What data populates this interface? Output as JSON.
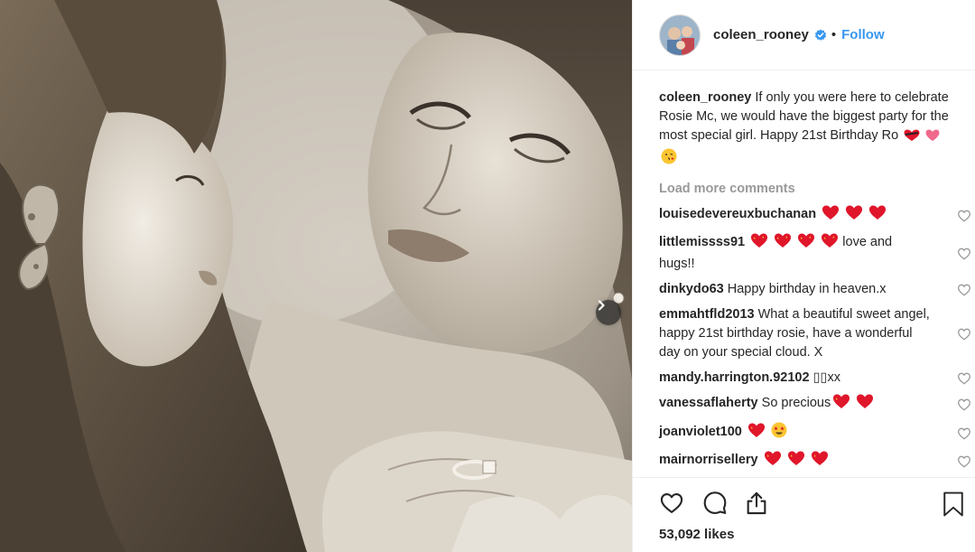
{
  "post": {
    "author": "coleen_rooney",
    "follow_label": "Follow",
    "dot": "•",
    "caption_text": "If only you were here to celebrate Rosie Mc, we would have the biggest party for the most special girl. Happy 21st Birthday Ro",
    "caption_emoji": [
      "heart-with-ribbon",
      "red-heart",
      "face-blowing-kiss"
    ],
    "load_more_label": "Load more comments",
    "likes_text": "53,092 likes"
  },
  "comments": [
    {
      "user": "louisedevereuxbuchanan",
      "text": "",
      "emoji": [
        "red-heart",
        "red-heart",
        "red-heart"
      ]
    },
    {
      "user": "littlemissss91",
      "text": "love and hugs!!",
      "emoji_before": [
        "sparkling-heart",
        "sparkling-heart",
        "sparkling-heart",
        "sparkling-heart"
      ]
    },
    {
      "user": "dinkydo63",
      "text": "Happy birthday in heaven.x"
    },
    {
      "user": "emmahtfld2013",
      "text": "What a beautiful sweet angel, happy 21st birthday rosie, have a wonderful day on your special cloud. X"
    },
    {
      "user": "mandy.harrington.92102",
      "text": "▯▯xx"
    },
    {
      "user": "vanessaflaherty",
      "text": "So precious",
      "emoji": [
        "sparkling-heart",
        "red-heart"
      ]
    },
    {
      "user": "joanviolet100",
      "text": "",
      "emoji": [
        "sparkling-heart",
        "star-struck"
      ]
    },
    {
      "user": "mairnorrisellery",
      "text": "",
      "emoji": [
        "sparkling-heart",
        "sparkling-heart",
        "sparkling-heart"
      ]
    }
  ],
  "icons": {
    "like": "heart-outline-icon",
    "comment": "comment-bubble-icon",
    "share": "share-icon",
    "save": "bookmark-icon",
    "verified": "verified-badge-icon",
    "next": "chevron-right-icon"
  },
  "colors": {
    "link_blue": "#3897f0",
    "heart_red": "#e0162b",
    "verified_blue": "#3897f0",
    "muted": "#999999"
  }
}
